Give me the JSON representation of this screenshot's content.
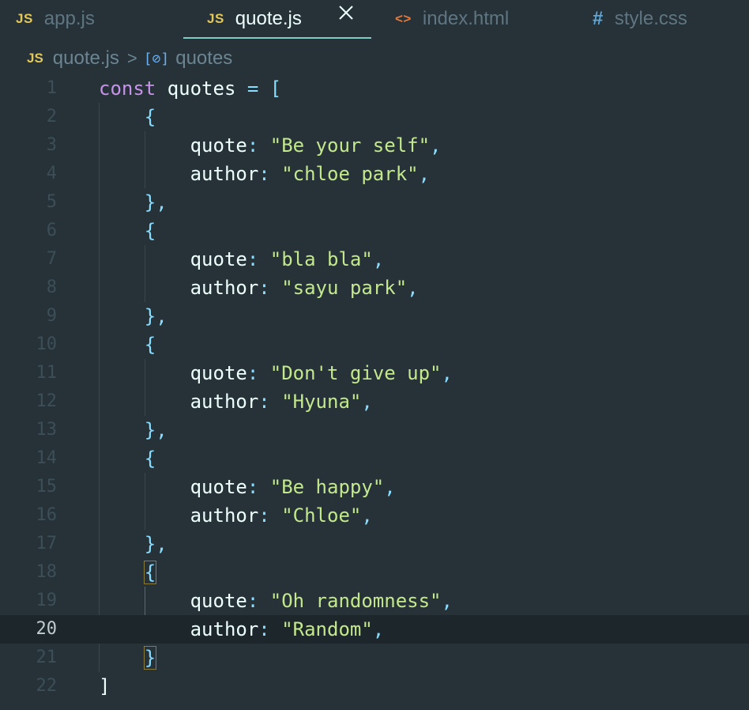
{
  "tabs": [
    {
      "icon": "JS",
      "label": "app.js",
      "active": false
    },
    {
      "icon": "JS",
      "label": "quote.js",
      "active": true
    },
    {
      "icon": "<>",
      "label": "index.html",
      "active": false
    },
    {
      "icon": "#",
      "label": "style.css",
      "active": false
    }
  ],
  "breadcrumb": {
    "file_icon": "JS",
    "file": "quote.js",
    "separator": ">",
    "symbol_icon": "[⊘]",
    "symbol": "quotes"
  },
  "code": {
    "keyword": "const",
    "variable": "quotes",
    "entries": [
      {
        "quote": "\"Be your self\"",
        "author": "\"chloe park\""
      },
      {
        "quote": "\"bla bla\"",
        "author": "\"sayu park\""
      },
      {
        "quote": "\"Don't give up\"",
        "author": "\"Hyuna\""
      },
      {
        "quote": "\"Be happy\"",
        "author": "\"Chloe\""
      },
      {
        "quote": "\"Oh randomness\"",
        "author": "\"Random\""
      }
    ],
    "prop_quote": "quote",
    "prop_author": "author"
  },
  "line_numbers": [
    "1",
    "2",
    "3",
    "4",
    "5",
    "6",
    "7",
    "8",
    "9",
    "10",
    "11",
    "12",
    "13",
    "14",
    "15",
    "16",
    "17",
    "18",
    "19",
    "20",
    "21",
    "22"
  ],
  "current_line": "20",
  "colors": {
    "background": "#263238",
    "keyword": "#c792ea",
    "string": "#c3e88d",
    "punctuation": "#89ddff",
    "tab_underline": "#80cbc4"
  }
}
